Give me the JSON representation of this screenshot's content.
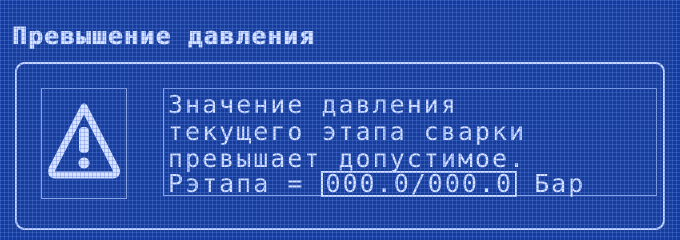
{
  "dialog": {
    "title": "Превышение давления",
    "message_lines": [
      "Значение давления",
      "текущего этапа сварки",
      "превышает допустимое."
    ],
    "pressure_label": "Рэтапа =",
    "pressure_value": "000.0/000.0",
    "pressure_unit": "Бар",
    "icon": "warning-triangle-icon",
    "colors": {
      "background": "#0f2f8a",
      "foreground": "#d8e2ff"
    }
  }
}
